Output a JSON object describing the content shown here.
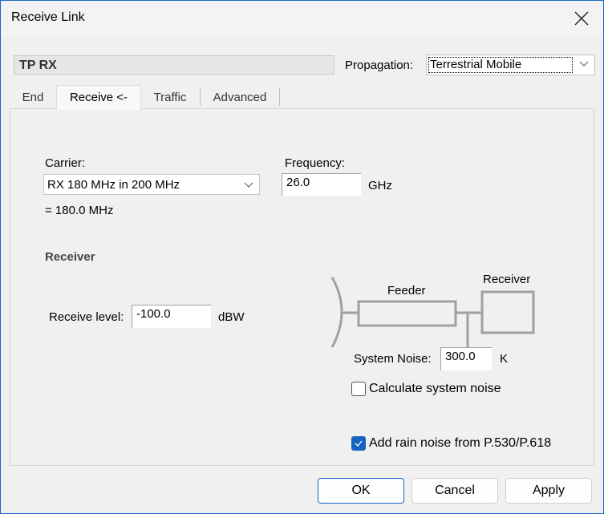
{
  "window": {
    "title": "Receive Link"
  },
  "header": {
    "link_name": "TP RX",
    "propagation_label": "Propagation:",
    "propagation_value": "Terrestrial Mobile"
  },
  "tabs": [
    {
      "label": "End",
      "active": false
    },
    {
      "label": "Receive <-",
      "active": true
    },
    {
      "label": "Traffic",
      "active": false
    },
    {
      "label": "Advanced",
      "active": false
    }
  ],
  "receive_tab": {
    "carrier_label": "Carrier:",
    "carrier_value": "RX 180 MHz in 200 MHz",
    "carrier_equals": "= 180.0 MHz",
    "frequency_label": "Frequency:",
    "frequency_value": "26.0",
    "frequency_unit": "GHz",
    "receiver_section_title": "Receiver",
    "receive_level_label": "Receive level:",
    "receive_level_value": "-100.0",
    "receive_level_unit": "dBW",
    "diagram": {
      "feeder_label": "Feeder",
      "receiver_label": "Receiver"
    },
    "system_noise_label": "System Noise:",
    "system_noise_value": "300.0",
    "system_noise_unit": "K",
    "calculate_system_noise": {
      "label": "Calculate system noise",
      "checked": false
    },
    "add_rain_noise": {
      "label": "Add rain noise from P.530/P.618",
      "checked": true
    }
  },
  "footer": {
    "ok_label": "OK",
    "cancel_label": "Cancel",
    "apply_label": "Apply"
  },
  "colors": {
    "accent": "#1764c0",
    "window_border": "#1a64c8",
    "diagram_stroke": "#a0a0a0"
  }
}
